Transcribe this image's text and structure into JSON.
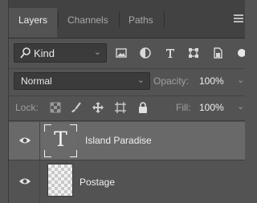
{
  "tabs": [
    {
      "label": "Layers",
      "active": true
    },
    {
      "label": "Channels",
      "active": false
    },
    {
      "label": "Paths",
      "active": false
    }
  ],
  "panel_menu_icon": "hamburger-icon",
  "filter": {
    "kind_label": "Kind",
    "icons": [
      "image-filter-icon",
      "adjustment-filter-icon",
      "type-filter-icon",
      "shape-filter-icon",
      "smart-object-filter-icon",
      "filter-toggle-icon"
    ]
  },
  "blend": {
    "mode": "Normal",
    "opacity_label": "Opacity:",
    "opacity_value": "100%"
  },
  "lock": {
    "label": "Lock:",
    "icons": [
      "lock-transparent-pixels-icon",
      "lock-image-pixels-icon",
      "lock-position-icon",
      "lock-artboard-icon",
      "lock-all-icon"
    ],
    "fill_label": "Fill:",
    "fill_value": "100%"
  },
  "layers": [
    {
      "name": "Island Paradise",
      "type": "text",
      "thumbnail_glyph": "T",
      "visible": true,
      "selected": true
    },
    {
      "name": "Postage",
      "type": "raster",
      "visible": true,
      "selected": false
    }
  ],
  "colors": {
    "panel_bg": "#535353",
    "tab_bar_bg": "#424242",
    "selected_layer_bg": "#696969",
    "field_bg": "#3b3b3b"
  }
}
